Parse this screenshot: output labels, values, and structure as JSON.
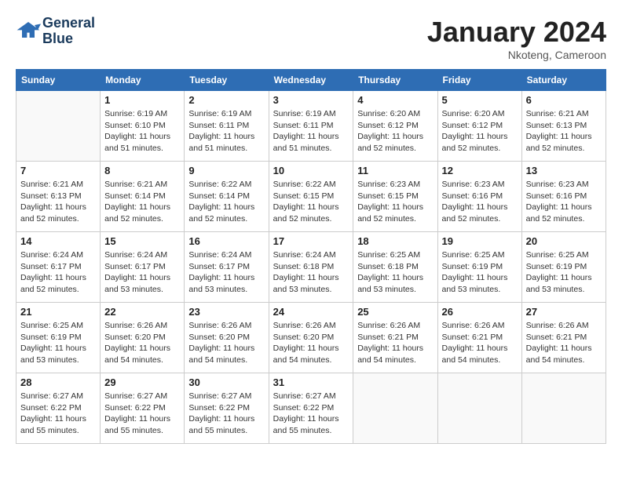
{
  "header": {
    "logo_line1": "General",
    "logo_line2": "Blue",
    "month": "January 2024",
    "location": "Nkoteng, Cameroon"
  },
  "weekdays": [
    "Sunday",
    "Monday",
    "Tuesday",
    "Wednesday",
    "Thursday",
    "Friday",
    "Saturday"
  ],
  "weeks": [
    [
      {
        "day": "",
        "info": ""
      },
      {
        "day": "1",
        "info": "Sunrise: 6:19 AM\nSunset: 6:10 PM\nDaylight: 11 hours\nand 51 minutes."
      },
      {
        "day": "2",
        "info": "Sunrise: 6:19 AM\nSunset: 6:11 PM\nDaylight: 11 hours\nand 51 minutes."
      },
      {
        "day": "3",
        "info": "Sunrise: 6:19 AM\nSunset: 6:11 PM\nDaylight: 11 hours\nand 51 minutes."
      },
      {
        "day": "4",
        "info": "Sunrise: 6:20 AM\nSunset: 6:12 PM\nDaylight: 11 hours\nand 52 minutes."
      },
      {
        "day": "5",
        "info": "Sunrise: 6:20 AM\nSunset: 6:12 PM\nDaylight: 11 hours\nand 52 minutes."
      },
      {
        "day": "6",
        "info": "Sunrise: 6:21 AM\nSunset: 6:13 PM\nDaylight: 11 hours\nand 52 minutes."
      }
    ],
    [
      {
        "day": "7",
        "info": "Sunrise: 6:21 AM\nSunset: 6:13 PM\nDaylight: 11 hours\nand 52 minutes."
      },
      {
        "day": "8",
        "info": "Sunrise: 6:21 AM\nSunset: 6:14 PM\nDaylight: 11 hours\nand 52 minutes."
      },
      {
        "day": "9",
        "info": "Sunrise: 6:22 AM\nSunset: 6:14 PM\nDaylight: 11 hours\nand 52 minutes."
      },
      {
        "day": "10",
        "info": "Sunrise: 6:22 AM\nSunset: 6:15 PM\nDaylight: 11 hours\nand 52 minutes."
      },
      {
        "day": "11",
        "info": "Sunrise: 6:23 AM\nSunset: 6:15 PM\nDaylight: 11 hours\nand 52 minutes."
      },
      {
        "day": "12",
        "info": "Sunrise: 6:23 AM\nSunset: 6:16 PM\nDaylight: 11 hours\nand 52 minutes."
      },
      {
        "day": "13",
        "info": "Sunrise: 6:23 AM\nSunset: 6:16 PM\nDaylight: 11 hours\nand 52 minutes."
      }
    ],
    [
      {
        "day": "14",
        "info": "Sunrise: 6:24 AM\nSunset: 6:17 PM\nDaylight: 11 hours\nand 52 minutes."
      },
      {
        "day": "15",
        "info": "Sunrise: 6:24 AM\nSunset: 6:17 PM\nDaylight: 11 hours\nand 53 minutes."
      },
      {
        "day": "16",
        "info": "Sunrise: 6:24 AM\nSunset: 6:17 PM\nDaylight: 11 hours\nand 53 minutes."
      },
      {
        "day": "17",
        "info": "Sunrise: 6:24 AM\nSunset: 6:18 PM\nDaylight: 11 hours\nand 53 minutes."
      },
      {
        "day": "18",
        "info": "Sunrise: 6:25 AM\nSunset: 6:18 PM\nDaylight: 11 hours\nand 53 minutes."
      },
      {
        "day": "19",
        "info": "Sunrise: 6:25 AM\nSunset: 6:19 PM\nDaylight: 11 hours\nand 53 minutes."
      },
      {
        "day": "20",
        "info": "Sunrise: 6:25 AM\nSunset: 6:19 PM\nDaylight: 11 hours\nand 53 minutes."
      }
    ],
    [
      {
        "day": "21",
        "info": "Sunrise: 6:25 AM\nSunset: 6:19 PM\nDaylight: 11 hours\nand 53 minutes."
      },
      {
        "day": "22",
        "info": "Sunrise: 6:26 AM\nSunset: 6:20 PM\nDaylight: 11 hours\nand 54 minutes."
      },
      {
        "day": "23",
        "info": "Sunrise: 6:26 AM\nSunset: 6:20 PM\nDaylight: 11 hours\nand 54 minutes."
      },
      {
        "day": "24",
        "info": "Sunrise: 6:26 AM\nSunset: 6:20 PM\nDaylight: 11 hours\nand 54 minutes."
      },
      {
        "day": "25",
        "info": "Sunrise: 6:26 AM\nSunset: 6:21 PM\nDaylight: 11 hours\nand 54 minutes."
      },
      {
        "day": "26",
        "info": "Sunrise: 6:26 AM\nSunset: 6:21 PM\nDaylight: 11 hours\nand 54 minutes."
      },
      {
        "day": "27",
        "info": "Sunrise: 6:26 AM\nSunset: 6:21 PM\nDaylight: 11 hours\nand 54 minutes."
      }
    ],
    [
      {
        "day": "28",
        "info": "Sunrise: 6:27 AM\nSunset: 6:22 PM\nDaylight: 11 hours\nand 55 minutes."
      },
      {
        "day": "29",
        "info": "Sunrise: 6:27 AM\nSunset: 6:22 PM\nDaylight: 11 hours\nand 55 minutes."
      },
      {
        "day": "30",
        "info": "Sunrise: 6:27 AM\nSunset: 6:22 PM\nDaylight: 11 hours\nand 55 minutes."
      },
      {
        "day": "31",
        "info": "Sunrise: 6:27 AM\nSunset: 6:22 PM\nDaylight: 11 hours\nand 55 minutes."
      },
      {
        "day": "",
        "info": ""
      },
      {
        "day": "",
        "info": ""
      },
      {
        "day": "",
        "info": ""
      }
    ]
  ]
}
